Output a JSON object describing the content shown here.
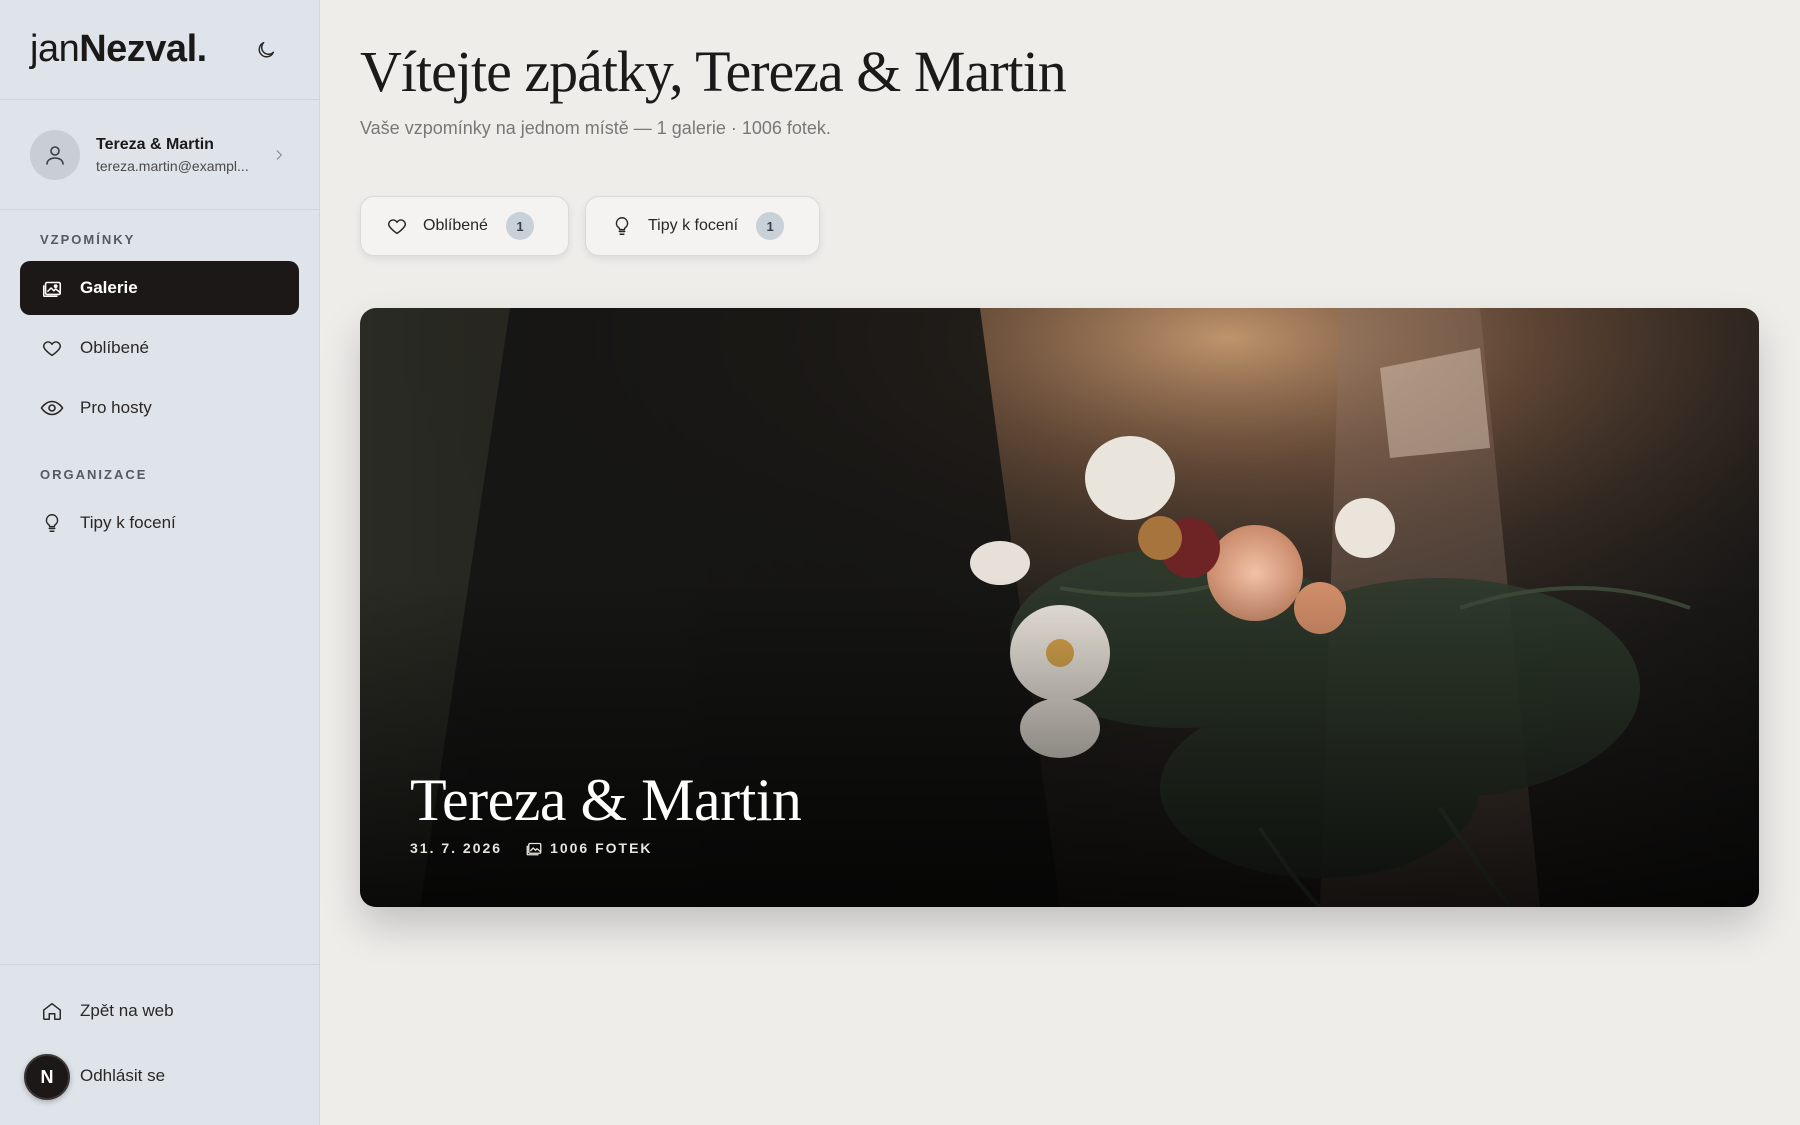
{
  "brand": {
    "prefix": "jan",
    "name": "Nezval",
    "suffix": "."
  },
  "user": {
    "name": "Tereza & Martin",
    "email": "tereza.martin@exampl..."
  },
  "sidebar": {
    "sections": [
      {
        "label": "VZPOMÍNKY"
      },
      {
        "label": "ORGANIZACE"
      }
    ],
    "items": [
      {
        "label": "Galerie",
        "icon": "gallery-icon",
        "active": true
      },
      {
        "label": "Oblíbené",
        "icon": "heart-icon"
      },
      {
        "label": "Pro hosty",
        "icon": "eye-icon"
      },
      {
        "label": "Tipy k focení",
        "icon": "lightbulb-icon"
      }
    ],
    "bottom": [
      {
        "label": "Zpět na web",
        "icon": "home-icon"
      },
      {
        "label": "Odhlásit se",
        "icon": "logout-icon"
      }
    ]
  },
  "main": {
    "title": "Vítejte zpátky, Tereza & Martin",
    "subtitle": "Vaše vzpomínky na jednom místě — 1 galerie · 1006 fotek.",
    "chips": [
      {
        "label": "Oblíbené",
        "count": "1",
        "icon": "heart-icon"
      },
      {
        "label": "Tipy k focení",
        "count": "1",
        "icon": "lightbulb-icon"
      }
    ],
    "gallery": {
      "title": "Tereza & Martin",
      "date": "31. 7. 2026",
      "photos": "1006 FOTEK"
    }
  },
  "colors": {
    "accent": "#1b1817",
    "sidebar_bg": "#dfe4ea",
    "page_bg": "#efedea",
    "badge": "#c8d0d8"
  }
}
